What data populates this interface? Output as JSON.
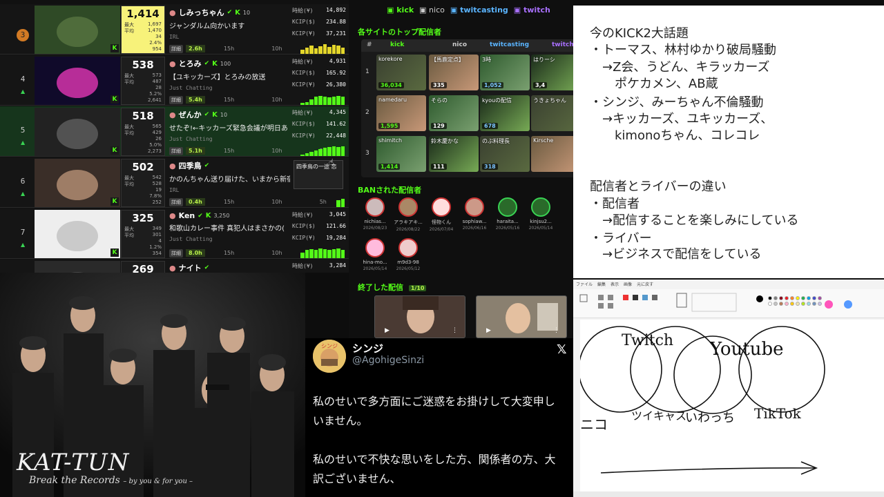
{
  "ranking": {
    "rows": [
      {
        "rank": "3",
        "medal": true,
        "big": "1,414",
        "max_label": "最大",
        "max": "1,697",
        "avg_label": "平均",
        "avg": "1,470",
        "r3": "34",
        "pct": "2.4%",
        "total": "954",
        "name": "しみっちゃん",
        "level": "10",
        "title": "ジャンダルム向かいます",
        "category": "IRL",
        "duration": "2.6h",
        "t1": "15h",
        "t2": "10h",
        "t3": "5h",
        "jpy": "14,892",
        "usd": "234.88",
        "kcip": "37,231",
        "highlight": false,
        "yellow": true
      },
      {
        "rank": "4",
        "medal": false,
        "big": "538",
        "max_label": "最大",
        "max": "573",
        "avg_label": "平均",
        "avg": "487",
        "r3": "28",
        "pct": "5.2%",
        "total": "2,641",
        "name": "とろみ",
        "level": "100",
        "title": "【ユキッカーズ】とろみの放送",
        "category": "Just Chatting",
        "duration": "5.4h",
        "t1": "15h",
        "t2": "10h",
        "t3": "5h",
        "jpy": "4,931",
        "usd": "165.92",
        "kcip": "26,380",
        "highlight": false,
        "yellow": false
      },
      {
        "rank": "5",
        "medal": false,
        "big": "518",
        "max_label": "最大",
        "max": "565",
        "avg_label": "平均",
        "avg": "429",
        "r3": "26",
        "pct": "5.0%",
        "total": "2,273",
        "name": "ぜんか",
        "level": "10",
        "title": "せたぞ!←キッカーズ緊急会議が明日あ",
        "category": "Just Chatting",
        "duration": "5.1h",
        "t1": "15h",
        "t2": "10h",
        "t3": "5h",
        "jpy": "4,345",
        "usd": "141.62",
        "kcip": "22,448",
        "highlight": true,
        "yellow": false
      },
      {
        "rank": "6",
        "medal": false,
        "big": "502",
        "max_label": "最大",
        "max": "542",
        "avg_label": "平均",
        "avg": "528",
        "r3": "19",
        "pct": "7.8%",
        "total": "252",
        "name": "四季鳥",
        "level": "",
        "title": "かのんちゃん送り届けた、いまから新宿",
        "category": "IRL",
        "duration": "0.4h",
        "t1": "15h",
        "t2": "10h",
        "t3": "5h",
        "jpy": "",
        "usd": "",
        "kcip": "",
        "highlight": false,
        "yellow": false
      },
      {
        "rank": "7",
        "medal": false,
        "big": "325",
        "max_label": "最大",
        "max": "349",
        "avg_label": "平均",
        "avg": "301",
        "r3": "4",
        "pct": "1.2%",
        "total": "354",
        "name": "Ken",
        "level": "3,250",
        "title": "和歌山カレー事件 真犯人はまさかの(",
        "category": "Just Chatting",
        "duration": "8.0h",
        "t1": "15h",
        "t2": "10h",
        "t3": "5h",
        "jpy": "3,045",
        "usd": "121.66",
        "kcip": "19,284",
        "highlight": false,
        "yellow": false
      },
      {
        "rank": "",
        "medal": false,
        "big": "269",
        "name": "ナイト",
        "jpy": "3,284",
        "usd": "127.77",
        "kcip": "20,253"
      }
    ],
    "labels": {
      "jpy": "時給(¥)",
      "usd": "KCIP($)",
      "kcip": "KCIP(¥)",
      "detail": "詳細"
    },
    "popup_text": "四季鳥の一途 恋",
    "extra_values": [
      "1,083",
      "9.11"
    ]
  },
  "sites": {
    "legend": {
      "kick": "kick",
      "nico": "nico",
      "twitcasting": "twitcasting",
      "twitch": "twitch"
    },
    "top_heading": "各サイトのトップ配信者",
    "table_head": {
      "num": "#",
      "kick": "kick",
      "nico": "nico",
      "twitcasting": "twitcasting",
      "twitch": "twitch"
    },
    "rows": [
      {
        "num": "1",
        "cells": [
          {
            "name": "korekore",
            "count": "36,034",
            "kind": "green"
          },
          {
            "name": "【馬鹿定点】",
            "count": "335",
            "kind": "normal"
          },
          {
            "name": "3時",
            "count": "1,052",
            "kind": "blue"
          },
          {
            "name": "はりーシ",
            "count": "3,4",
            "kind": "normal"
          }
        ]
      },
      {
        "num": "2",
        "cells": [
          {
            "name": "namedaru",
            "count": "",
            "kind": "green"
          },
          {
            "name": "そらの",
            "count": "129",
            "kind": "normal"
          },
          {
            "name": "kyouの配信",
            "count": "678",
            "kind": "blue"
          },
          {
            "name": "うきょちゃん",
            "count": "",
            "kind": "normal"
          }
        ]
      },
      {
        "num": "3",
        "cells": [
          {
            "name": "shimitch",
            "count": "1,414",
            "kind": "green"
          },
          {
            "name": "鈴木慶かな",
            "count": "111",
            "kind": "normal"
          },
          {
            "name": "のぶ料理長",
            "count": "318",
            "kind": "blue"
          },
          {
            "name": "Kirsche",
            "count": "",
            "kind": "normal"
          }
        ]
      }
    ],
    "row2_first_count": "1,595",
    "ban_heading": "BANされた配信者",
    "banned": [
      {
        "name": "nichias...",
        "date": "2026/08/23",
        "green": false
      },
      {
        "name": "アラキアキ...",
        "date": "2026/08/22",
        "green": false
      },
      {
        "name": "怪物くん",
        "date": "2026/07/04",
        "green": false
      },
      {
        "name": "sophiaw...",
        "date": "2026/06/16",
        "green": false
      },
      {
        "name": "haraita...",
        "date": "2026/05/16",
        "green": true
      },
      {
        "name": "kinjsu2...",
        "date": "2026/05/14",
        "green": true
      },
      {
        "name": "hina-mo...",
        "date": "2026/05/14",
        "green": false
      },
      {
        "name": "m9d3-98",
        "date": "2026/05/12",
        "green": false
      }
    ],
    "ended_heading": "終了した配信",
    "ended_badge": "1/10"
  },
  "notes": {
    "lines": [
      "今のKICK2大話題",
      "・トーマス、林村ゆかり破局騒動",
      "　→Z会、うどん、キラッカーズ",
      "　　ポケカメン、AB蔵",
      "・シンジ、みーちゃん不倫騒動",
      "　→キッカーズ、ユキッカーズ、",
      "　　kimonoちゃん、コレコレ",
      "",
      "配信者とライバーの違い",
      "・配信者",
      "　→配信することを楽しみにしている",
      "・ライバー",
      "　→ビジネスで配信をしている"
    ]
  },
  "paint": {
    "menu": [
      "ファイル",
      "編集",
      "表示",
      "画像",
      "元に戻す"
    ],
    "handwriting": {
      "twitch": "Twitch",
      "youtube": "Youtube",
      "nico": "ニコ",
      "twitcasting": "ツイキャス",
      "iriam": "いわっち",
      "tiktok": "TikTok"
    },
    "colors": [
      "#000000",
      "#7f7f7f",
      "#880015",
      "#ed1c24",
      "#ff7f27",
      "#fff200",
      "#22b14c",
      "#00a2e8",
      "#3f48cc",
      "#a349a4",
      "#ffffff",
      "#c3c3c3",
      "#b97a57",
      "#ffaec9",
      "#ffc90e",
      "#efe4b0",
      "#b5e61d",
      "#99d9ea",
      "#7092be",
      "#c8bfe7"
    ]
  },
  "katimg": {
    "logo": "KAT-TUN",
    "subtitle": "Break the Records",
    "subtitle_small": "– by you & for you –"
  },
  "tweet": {
    "name": "シンジ",
    "handle": "@AgohigeSinzi",
    "lines": [
      "私のせいで多方面にご迷惑をお掛けして大変申し",
      "いません。",
      "私のせいで不快な思いをした方、関係者の方、大",
      "訳ございません、"
    ]
  }
}
